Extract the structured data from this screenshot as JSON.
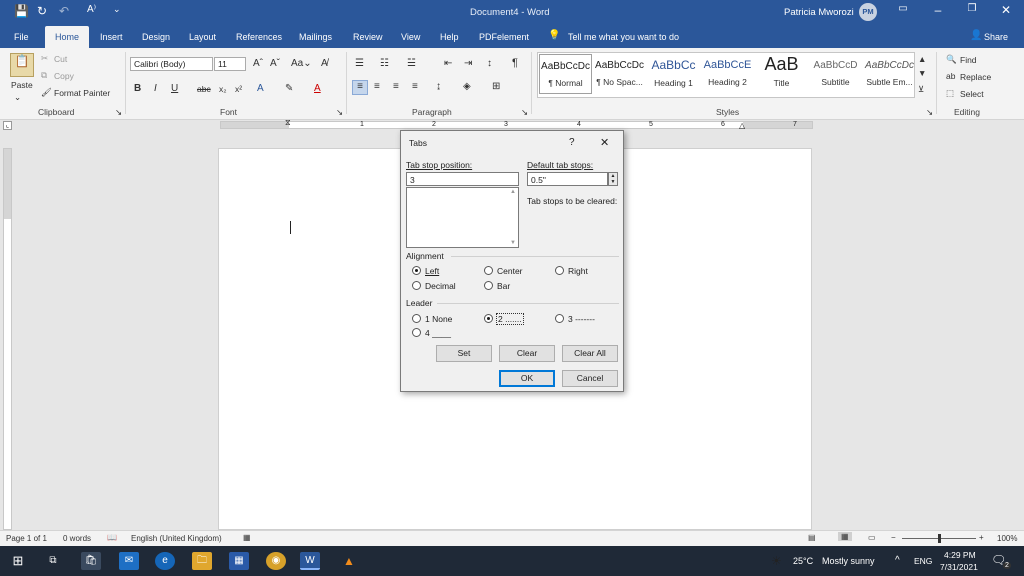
{
  "titlebar": {
    "doc_title": "Document4 - Word",
    "user": "Patricia Mworozi",
    "avatar": "PM"
  },
  "ribbon_tabs": [
    "File",
    "Home",
    "Insert",
    "Design",
    "Layout",
    "References",
    "Mailings",
    "Review",
    "View",
    "Help",
    "PDFelement"
  ],
  "tell_me": "Tell me what you want to do",
  "share": "Share",
  "clipboard": {
    "paste": "Paste",
    "cut": "Cut",
    "copy": "Copy",
    "format_painter": "Format Painter",
    "label": "Clipboard"
  },
  "font": {
    "name": "Calibri (Body)",
    "size": "11",
    "label": "Font"
  },
  "paragraph": {
    "label": "Paragraph"
  },
  "styles": {
    "label": "Styles",
    "items": [
      {
        "sample": "AaBbCcDc",
        "name": "¶ Normal"
      },
      {
        "sample": "AaBbCcDc",
        "name": "¶ No Spac..."
      },
      {
        "sample": "AaBbCc",
        "name": "Heading 1"
      },
      {
        "sample": "AaBbCcE",
        "name": "Heading 2"
      },
      {
        "sample": "AaB",
        "name": "Title"
      },
      {
        "sample": "AaBbCcD",
        "name": "Subtitle"
      },
      {
        "sample": "AaBbCcDc",
        "name": "Subtle Em..."
      }
    ]
  },
  "editing": {
    "find": "Find",
    "replace": "Replace",
    "select": "Select",
    "label": "Editing"
  },
  "ruler_numbers": [
    "1",
    "2",
    "3",
    "4",
    "5",
    "6",
    "7"
  ],
  "dialog": {
    "title": "Tabs",
    "help": "?",
    "tab_stop_label": "Tab stop position:",
    "tab_stop_value": "3",
    "default_label": "Default tab stops:",
    "default_value": "0.5\"",
    "cleared_label": "Tab stops to be cleared:",
    "alignment_label": "Alignment",
    "alignment": [
      "Left",
      "Center",
      "Right",
      "Decimal",
      "Bar"
    ],
    "alignment_selected": "Left",
    "leader_label": "Leader",
    "leader": [
      "1 None",
      "2 .......",
      "3 -------",
      "4 ____"
    ],
    "leader_selected": "2 .......",
    "set": "Set",
    "clear": "Clear",
    "clear_all": "Clear All",
    "ok": "OK",
    "cancel": "Cancel"
  },
  "status": {
    "page": "Page 1 of 1",
    "words": "0 words",
    "language": "English (United Kingdom)",
    "zoom": "100%"
  },
  "taskbar": {
    "weather_temp": "25°C",
    "weather_desc": "Mostly sunny",
    "lang": "ENG",
    "time": "4:29 PM",
    "date": "7/31/2021",
    "notifications": "2"
  },
  "colors": {
    "word_blue": "#2b579a",
    "taskbar": "#1f2937",
    "focus": "#0078d7"
  }
}
